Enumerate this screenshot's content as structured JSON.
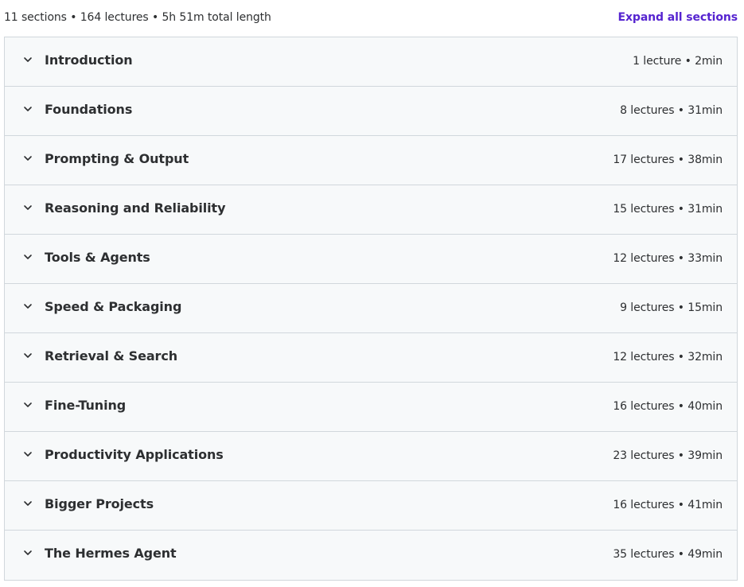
{
  "summary": "11 sections • 164 lectures • 5h 51m total length",
  "expand_label": "Expand all sections",
  "sections": [
    {
      "title": "Introduction",
      "meta": "1 lecture • 2min"
    },
    {
      "title": "Foundations",
      "meta": "8 lectures • 31min"
    },
    {
      "title": "Prompting & Output",
      "meta": "17 lectures • 38min"
    },
    {
      "title": "Reasoning and Reliability",
      "meta": "15 lectures • 31min"
    },
    {
      "title": "Tools & Agents",
      "meta": "12 lectures • 33min"
    },
    {
      "title": "Speed & Packaging",
      "meta": "9 lectures • 15min"
    },
    {
      "title": "Retrieval & Search",
      "meta": "12 lectures • 32min"
    },
    {
      "title": "Fine-Tuning",
      "meta": "16 lectures • 40min"
    },
    {
      "title": "Productivity Applications",
      "meta": "23 lectures • 39min"
    },
    {
      "title": "Bigger Projects",
      "meta": "16 lectures • 41min"
    },
    {
      "title": "The Hermes Agent",
      "meta": "35 lectures • 49min"
    }
  ],
  "colors": {
    "accent": "#5624d0",
    "row_bg": "#f7f9fa",
    "border": "#d1d7dc",
    "text": "#2d2f31"
  },
  "icons": {
    "section_toggle": "chevron-down-icon"
  }
}
